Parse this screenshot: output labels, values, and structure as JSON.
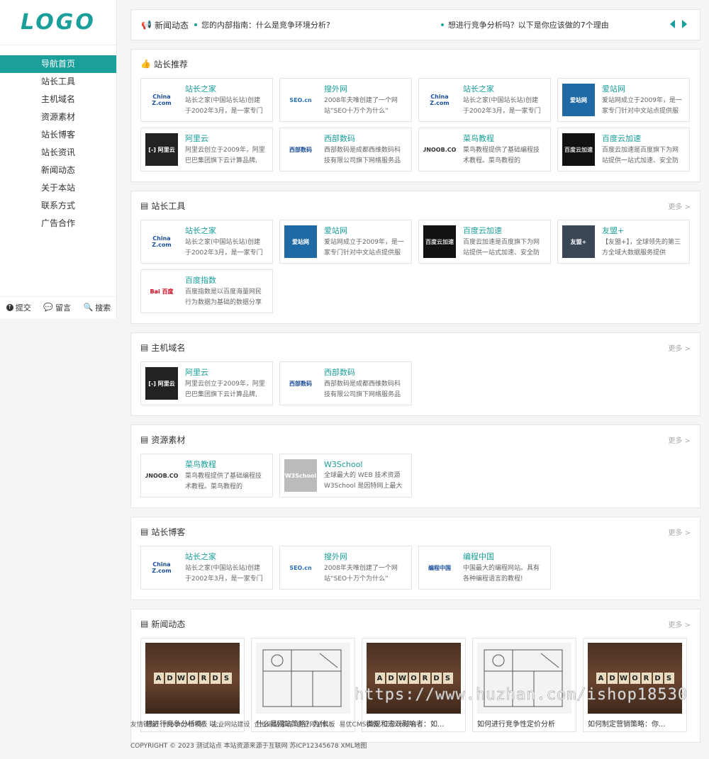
{
  "logo": "LOGO",
  "nav": [
    "导航首页",
    "站长工具",
    "主机域名",
    "资源素材",
    "站长博客",
    "站长资讯",
    "新闻动态",
    "关于本站",
    "联系方式",
    "广告合作"
  ],
  "side_actions": [
    "提交",
    "留言",
    "搜索"
  ],
  "topbar": {
    "label": "新闻动态",
    "news": [
      "您的内部指南：什么是竞争环境分析?",
      "想进行竞争分析吗？以下是你应该做的7个理由"
    ]
  },
  "sections": [
    {
      "title": "站长推荐",
      "more": "",
      "cards": [
        {
          "title": "站长之家",
          "desc": "站长之家(中国站长站)创建于2002年3月，是一家专门针",
          "thumb": "China Z.com",
          "tcolor": "#fff",
          "tfg": "#1b4e9b"
        },
        {
          "title": "搜外网",
          "desc": "2008年夫唯创建了一个网站“SEO十万个为什么”",
          "thumb": "SEO.cn",
          "tcolor": "#fff",
          "tfg": "#2a6fb5"
        },
        {
          "title": "站长之家",
          "desc": "站长之家(中国站长站)创建于2002年3月，是一家专门针",
          "thumb": "China Z.com",
          "tcolor": "#fff",
          "tfg": "#1b4e9b"
        },
        {
          "title": "爱站网",
          "desc": "爱站网成立于2009年，是一家专门针对中文站点提供服",
          "thumb": "爱站网",
          "tcolor": "#1f6aa5",
          "tfg": "#fff"
        },
        {
          "title": "阿里云",
          "desc": "阿里云创立于2009年，阿里巴巴集团旗下云计算品牌,",
          "thumb": "[-] 阿里云",
          "tcolor": "#222",
          "tfg": "#fff"
        },
        {
          "title": "西部数码",
          "desc": "西部数码是成都西维数码科技有限公司旗下网络服务品",
          "thumb": "西部数码",
          "tcolor": "#fff",
          "tfg": "#1b4e9b"
        },
        {
          "title": "菜鸟教程",
          "desc": "菜鸟教程提供了基础编程技术教程。菜鸟教程的 Slogan",
          "thumb": "RUNOOB.COM",
          "tcolor": "#fff",
          "tfg": "#333"
        },
        {
          "title": "百度云加速",
          "desc": "百度云加速是百度旗下为网站提供一站式加速、安全防",
          "thumb": "百度云加速",
          "tcolor": "#111",
          "tfg": "#ddd"
        }
      ]
    },
    {
      "title": "站长工具",
      "more": "更多 >",
      "cards": [
        {
          "title": "站长之家",
          "desc": "站长之家(中国站长站)创建于2002年3月，是一家专门针",
          "thumb": "China Z.com",
          "tcolor": "#fff",
          "tfg": "#1b4e9b"
        },
        {
          "title": "爱站网",
          "desc": "爱站网成立于2009年，是一家专门针对中文站点提供服",
          "thumb": "爱站网",
          "tcolor": "#1f6aa5",
          "tfg": "#fff"
        },
        {
          "title": "百度云加速",
          "desc": "百度云加速是百度旗下为网站提供一站式加速、安全防",
          "thumb": "百度云加速",
          "tcolor": "#111",
          "tfg": "#ddd"
        },
        {
          "title": "友盟+",
          "desc": "【友盟+】，全球领先的第三方全域大数据服务提供",
          "thumb": "友盟+",
          "tcolor": "#3a4656",
          "tfg": "#fff"
        },
        {
          "title": "百度指数",
          "desc": "百度指数是以百度海量网民行为数据为基础的数据分享",
          "thumb": "Bai 百度",
          "tcolor": "#fff",
          "tfg": "#d0021b"
        }
      ]
    },
    {
      "title": "主机域名",
      "more": "更多 >",
      "cards": [
        {
          "title": "阿里云",
          "desc": "阿里云创立于2009年，阿里巴巴集团旗下云计算品牌,",
          "thumb": "[-] 阿里云",
          "tcolor": "#222",
          "tfg": "#fff"
        },
        {
          "title": "西部数码",
          "desc": "西部数码是成都西维数码科技有限公司旗下网络服务品",
          "thumb": "西部数码",
          "tcolor": "#fff",
          "tfg": "#1b4e9b"
        }
      ]
    },
    {
      "title": "资源素材",
      "more": "更多 >",
      "cards": [
        {
          "title": "菜鸟教程",
          "desc": "菜鸟教程提供了基础编程技术教程。菜鸟教程的 Slogan",
          "thumb": "RUNOOB.COM",
          "tcolor": "#fff",
          "tfg": "#333"
        },
        {
          "title": "W3School",
          "desc": "全球最大的 WEB 技术资源 W3School 是因特网上最大",
          "thumb": "W3School",
          "tcolor": "#bbb",
          "tfg": "#fff"
        }
      ]
    },
    {
      "title": "站长博客",
      "more": "更多 >",
      "cards": [
        {
          "title": "站长之家",
          "desc": "站长之家(中国站长站)创建于2002年3月，是一家专门针",
          "thumb": "China Z.com",
          "tcolor": "#fff",
          "tfg": "#1b4e9b"
        },
        {
          "title": "搜外网",
          "desc": "2008年夫唯创建了一个网站“SEO十万个为什么”",
          "thumb": "SEO.cn",
          "tcolor": "#fff",
          "tfg": "#2a6fb5"
        },
        {
          "title": "编程中国",
          "desc": "中国最大的编程网站。具有各种编程语言的教程!",
          "thumb": "编程中国",
          "tcolor": "#fff",
          "tfg": "#1b4e9b"
        }
      ]
    }
  ],
  "news_section": {
    "title": "新闻动态",
    "more": "更多 >",
    "items": [
      {
        "title": "想进行竞争分析吗？以...",
        "img": "wood"
      },
      {
        "title": "什么是网站策略？为什...",
        "img": "plan"
      },
      {
        "title": "微观和宏观影响者：如...",
        "img": "wood"
      },
      {
        "title": "如何进行竞争性定价分析",
        "img": "plan"
      },
      {
        "title": "如何制定营销策略：你...",
        "img": "wood"
      }
    ],
    "tile_letters": [
      "A",
      "D",
      "W",
      "O",
      "R",
      "D",
      "S"
    ]
  },
  "friend_links": {
    "label": "友情链接:",
    "links": [
      "PbootCMS模板",
      "企业网站建设",
      "企业网站源码",
      "企业网站模板",
      "易优CMS模板",
      "三杂cn域名"
    ]
  },
  "copyright": "COPYRIGHT © 2023 测试站点 本站资源来源于互联网 苏ICP12345678 XML地图",
  "watermark": "https://www.huzhan.com/ishop18530"
}
